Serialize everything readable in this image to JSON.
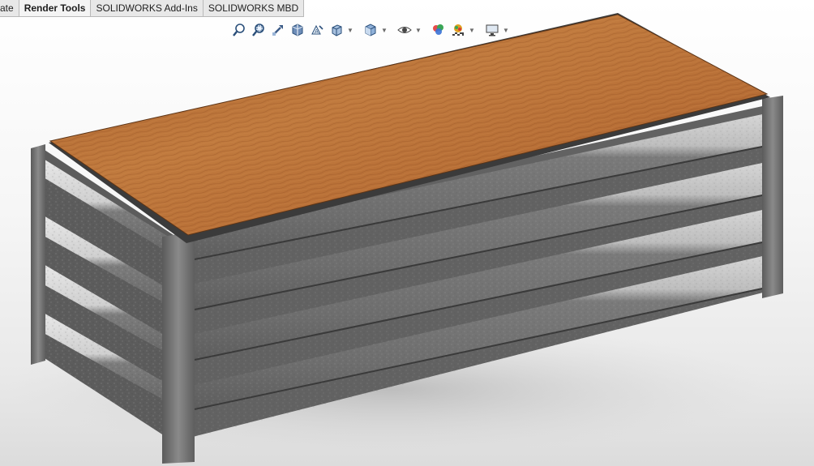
{
  "command_manager": {
    "tabs": [
      {
        "label": "ate",
        "active": false
      },
      {
        "label": "Render Tools",
        "active": true
      },
      {
        "label": "SOLIDWORKS Add-Ins",
        "active": false
      },
      {
        "label": "SOLIDWORKS MBD",
        "active": false
      }
    ]
  },
  "heads_up_toolbar": {
    "icons": [
      "zoom-to-fit-icon",
      "zoom-to-area-icon",
      "previous-view-icon",
      "section-view-icon",
      "dynamic-annotation-views-icon",
      "view-orientation-icon",
      "display-style-icon",
      "hide-show-items-icon",
      "edit-appearance-icon",
      "apply-scene-icon",
      "view-settings-icon"
    ]
  },
  "model_view": {
    "description_colors": {
      "wood_top": "#b46a33",
      "steel_frame": "#707070",
      "galvanized_slat": "#c9c9c9"
    }
  }
}
